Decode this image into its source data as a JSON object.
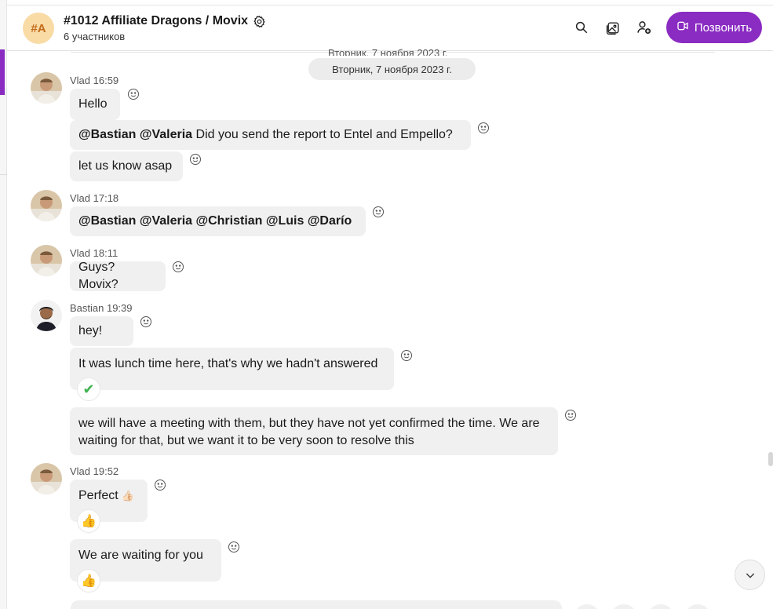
{
  "header": {
    "group_initials": "#A",
    "title": "#1012 Affiliate Dragons / Movix",
    "subtitle": "6 участников",
    "call_label": "Позвонить"
  },
  "date_label": "Вторник, 7 ноября 2023 г.",
  "messages": {
    "m1": {
      "sender": "Vlad 16:59",
      "text": "Hello"
    },
    "m2": {
      "mention1": "@Bastian",
      "mention2": "@Valeria",
      "text": " Did you send the report to Entel and Empello?"
    },
    "m3": {
      "text": "let us know asap"
    },
    "m4": {
      "sender": "Vlad 17:18",
      "text": "@Bastian @Valeria @Christian @Luis @Darío"
    },
    "m5": {
      "sender": "Vlad 18:11",
      "text": "Guys? Movix?"
    },
    "m6": {
      "sender": "Bastian 19:39",
      "text": "hey!"
    },
    "m7": {
      "text": "It was lunch time here, that's why we hadn't answered",
      "reaction": "✔"
    },
    "m8": {
      "text": "we will have a meeting with them, but they have not yet confirmed the time. We are waiting for that, but we want it to be very soon to resolve this"
    },
    "m9": {
      "sender": "Vlad 19:52",
      "text": "Perfect",
      "emoji": "👍🏻",
      "reaction": "👍"
    },
    "m10": {
      "text": "We are waiting for you",
      "reaction": "👍"
    }
  },
  "colors": {
    "accent": "#8a2bc2",
    "bubble": "#f0f0f0",
    "avatar_group_bg": "#f9dba6"
  },
  "icons": [
    "settings-gear-icon",
    "search-icon",
    "gallery-icon",
    "add-person-icon",
    "video-call-icon",
    "smiley-icon",
    "chevron-down-icon"
  ]
}
